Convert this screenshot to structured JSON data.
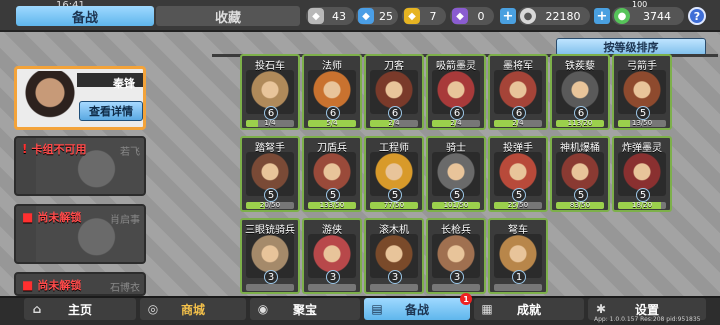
{
  "clock": "16:41",
  "tabs": {
    "active": "备战",
    "inactive": "收藏"
  },
  "resources": [
    {
      "icon": "silver-token-icon",
      "value": "43",
      "color": "#c8c8c8"
    },
    {
      "icon": "blue-token-icon",
      "value": "25",
      "color": "#4a9ee6"
    },
    {
      "icon": "gold-token-icon",
      "value": "7",
      "color": "#e6b422"
    },
    {
      "icon": "purple-token-icon",
      "value": "0",
      "color": "#8a5cd0"
    },
    {
      "icon": "silver-coin-icon",
      "value": "22180",
      "color": "#d8d8d8"
    },
    {
      "icon": "green-gem-icon",
      "value": "3744",
      "color": "#56c45a"
    }
  ],
  "energy": "100",
  "sort_label": "按等级排序",
  "commander": {
    "name": "秦锋",
    "detail_label": "查看详情"
  },
  "slots": [
    {
      "label": "卡组不可用",
      "ghost": "若飞",
      "kind": "warn"
    },
    {
      "label": "尚未解锁",
      "ghost": "肖启事",
      "kind": "lock"
    },
    {
      "label": "尚未解锁",
      "ghost": "石博衣",
      "kind": "lock"
    }
  ],
  "heroes": [
    {
      "name": "投石车",
      "level": "6",
      "progress": "1/4",
      "frac": 0.25,
      "color": "#b08a5a"
    },
    {
      "name": "法师",
      "level": "6",
      "progress": "5/4",
      "frac": 1.0,
      "color": "#c9722f"
    },
    {
      "name": "刀客",
      "level": "6",
      "progress": "2/4",
      "frac": 0.5,
      "color": "#7a3a2a"
    },
    {
      "name": "吸箭墨灵",
      "level": "6",
      "progress": "2/4",
      "frac": 0.5,
      "color": "#a83a3a"
    },
    {
      "name": "墨将军",
      "level": "6",
      "progress": "2/4",
      "frac": 0.5,
      "color": "#a54438"
    },
    {
      "name": "铁蒺藜",
      "level": "6",
      "progress": "113/20",
      "frac": 1.0,
      "color": "#5a5a5a"
    },
    {
      "name": "弓箭手",
      "level": "5",
      "progress": "13/50",
      "frac": 0.26,
      "color": "#8e4a2e"
    },
    {
      "name": "踏弩手",
      "level": "5",
      "progress": "20/50",
      "frac": 0.4,
      "color": "#7a4a36"
    },
    {
      "name": "刀盾兵",
      "level": "5",
      "progress": "133/50",
      "frac": 1.0,
      "color": "#9a4a3a"
    },
    {
      "name": "工程师",
      "level": "5",
      "progress": "77/50",
      "frac": 1.0,
      "color": "#d89a2a"
    },
    {
      "name": "骑士",
      "level": "5",
      "progress": "101/50",
      "frac": 1.0,
      "color": "#6a6a6a"
    },
    {
      "name": "投弹手",
      "level": "5",
      "progress": "25/50",
      "frac": 0.5,
      "color": "#b84a3a"
    },
    {
      "name": "神机爆桶",
      "level": "5",
      "progress": "83/50",
      "frac": 1.0,
      "color": "#8a3a32"
    },
    {
      "name": "炸弹墨灵",
      "level": "5",
      "progress": "18/20",
      "frac": 0.9,
      "color": "#8a3030"
    },
    {
      "name": "三眼铳骑兵",
      "level": "3",
      "progress": "",
      "frac": 0.0,
      "color": "#a58a6a"
    },
    {
      "name": "游侠",
      "level": "3",
      "progress": "",
      "frac": 0.0,
      "color": "#b8484a"
    },
    {
      "name": "滚木机",
      "level": "3",
      "progress": "",
      "frac": 0.0,
      "color": "#7a4a2a"
    },
    {
      "name": "长枪兵",
      "level": "3",
      "progress": "",
      "frac": 0.0,
      "color": "#a07050"
    },
    {
      "name": "弩车",
      "level": "1",
      "progress": "",
      "frac": 0.0,
      "color": "#b8864a"
    }
  ],
  "nav": [
    {
      "label": "主页",
      "icon": "home-icon"
    },
    {
      "label": "商城",
      "icon": "shop-icon"
    },
    {
      "label": "聚宝",
      "icon": "treasure-icon"
    },
    {
      "label": "备战",
      "icon": "cards-icon"
    },
    {
      "label": "成就",
      "icon": "achievement-icon"
    },
    {
      "label": "设置",
      "icon": "gear-icon"
    }
  ],
  "notification_count": "1",
  "version": "App: 1.0.0.157 Res:208 pid:951835"
}
